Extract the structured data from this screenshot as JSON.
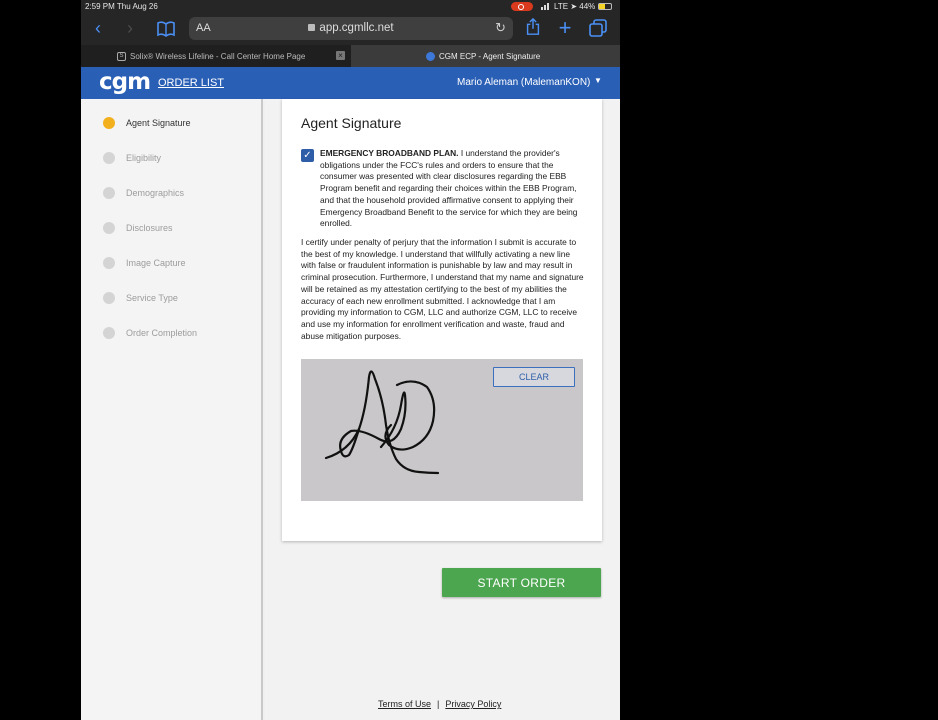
{
  "status_bar": {
    "time": "2:59 PM  Thu Aug 26",
    "network": "LTE",
    "battery": "44%"
  },
  "browser": {
    "aa_label": "AA",
    "url": "app.cgmllc.net",
    "tabs": [
      {
        "title": "Solix® Wireless Lifeline - Call Center Home Page",
        "active": false
      },
      {
        "title": "CGM ECP - Agent Signature",
        "active": true
      }
    ]
  },
  "header": {
    "logo": "cgm",
    "order_list": "ORDER LIST",
    "user": "Mario Aleman (MalemanKON)",
    "brand_color": "#2a5fb6"
  },
  "sidebar": {
    "steps": [
      {
        "label": "Agent Signature",
        "active": true
      },
      {
        "label": "Eligibility",
        "active": false
      },
      {
        "label": "Demographics",
        "active": false
      },
      {
        "label": "Disclosures",
        "active": false
      },
      {
        "label": "Image Capture",
        "active": false
      },
      {
        "label": "Service Type",
        "active": false
      },
      {
        "label": "Order Completion",
        "active": false
      }
    ],
    "active_color": "#f2b01e"
  },
  "card": {
    "title": "Agent Signature",
    "ebb_checked": true,
    "ebb_heading": "EMERGENCY BROADBAND PLAN.",
    "ebb_text": " I understand the provider's obligations under the FCC's rules and orders to ensure that the consumer was presented with clear disclosures regarding the EBB Program benefit and regarding their choices within the EBB Program, and that the household provided affirmative consent to applying their Emergency Broadband Benefit to the service for which they are being enrolled.",
    "certify_text": "I certify under penalty of perjury that the information I submit is accurate to the best of my knowledge. I understand that willfully activating a new line with false or fraudulent information is punishable by law and may result in criminal prosecution. Furthermore, I understand that my name and signature will be retained as my attestation certifying to the best of my abilities the accuracy of each new enrollment submitted. I acknowledge that I am providing my information to CGM, LLC and authorize CGM, LLC to receive and use my information for enrollment verification and waste, fraud and abuse mitigation purposes.",
    "clear_label": "CLEAR"
  },
  "start_order_label": "START ORDER",
  "start_order_color": "#4ca64f",
  "footer": {
    "terms": "Terms of Use",
    "separator": "|",
    "privacy": "Privacy Policy"
  }
}
